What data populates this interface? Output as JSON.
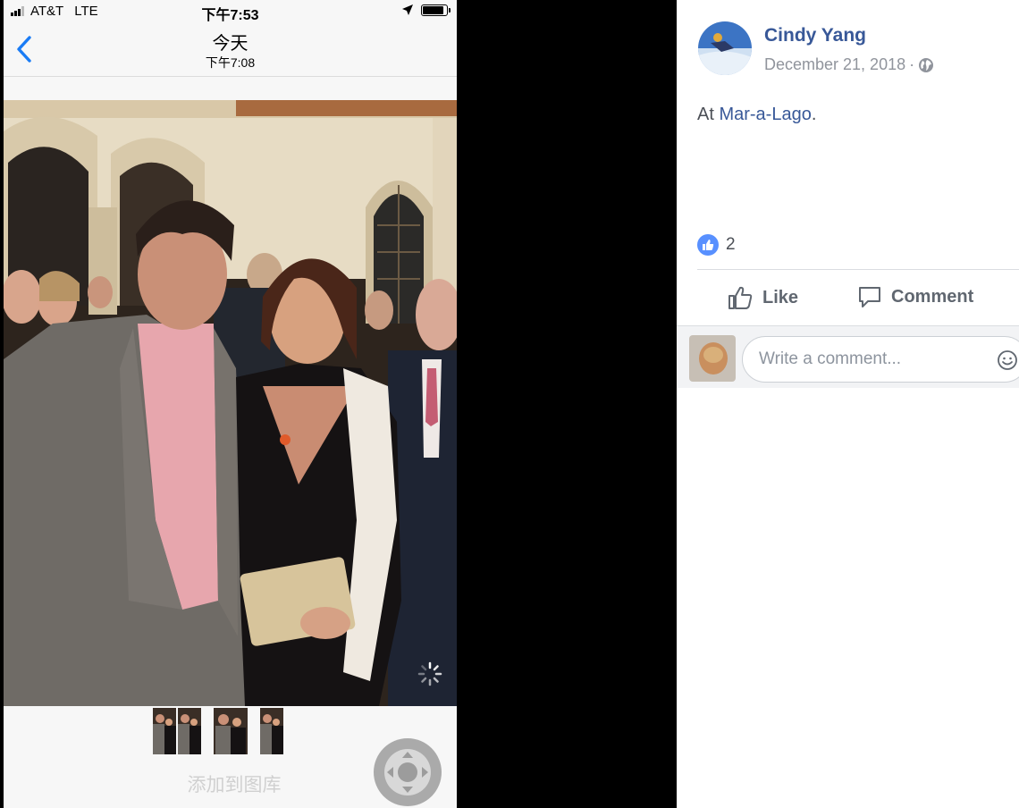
{
  "phone": {
    "status": {
      "carrier": "AT&T",
      "network": "LTE",
      "time": "下午7:53"
    },
    "nav": {
      "title": "今天",
      "subtitle": "下午7:08"
    },
    "footer": {
      "add_to_library": "添加到图库"
    }
  },
  "fb_post": {
    "author": "Cindy Yang",
    "date": "December 21, 2018",
    "date_separator": "·",
    "text_prefix": "At ",
    "location_link": "Mar-a-Lago",
    "text_suffix": ".",
    "reaction_count": "2",
    "actions": {
      "like": "Like",
      "comment": "Comment"
    },
    "comment_placeholder": "Write a comment..."
  },
  "colors": {
    "fb_link": "#385898",
    "fb_like": "#5890ff",
    "ios_blue": "#1a7cf5"
  }
}
